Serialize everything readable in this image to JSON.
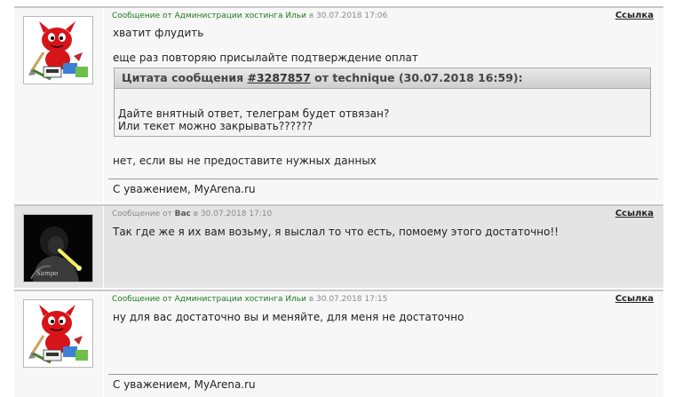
{
  "posts": [
    {
      "kind": "admin",
      "meta": {
        "prefix": "Сообщение от ",
        "author": "Администрации хостинга Ильи",
        "in": " в ",
        "datetime": "30.07.2018 17:06"
      },
      "link_label": "Ссылка",
      "lines": [
        "хватит флудить",
        "еще раз повторяю присылайте подтверждение оплат"
      ],
      "quote": {
        "prefix": "Цитата сообщения ",
        "number": "#3287857",
        "suffix": " от technique (30.07.2018 16:59):",
        "lines": [
          "Дайте внятный ответ, телеграм будет отвязан?",
          "Или текет можно закрывать??????"
        ]
      },
      "after_quote": "нет, если вы не предоставите нужных данных",
      "signature": "С уважением, MyArena.ru"
    },
    {
      "kind": "user",
      "meta": {
        "prefix": "Сообщение от ",
        "author": "Вас",
        "in": " в ",
        "datetime": "30.07.2018 17:10"
      },
      "link_label": "Ссылка",
      "lines": [
        "Так где же я их вам возьму, я выслал то что есть, помоему этого достаточно!!"
      ]
    },
    {
      "kind": "admin",
      "meta": {
        "prefix": "Сообщение от ",
        "author": "Администрации хостинга Ильи",
        "in": " в ",
        "datetime": "30.07.2018 17:15"
      },
      "link_label": "Ссылка",
      "lines": [
        "ну для вас достаточно вы и меняйте, для меня не достаточно"
      ],
      "signature": "С уважением, MyArena.ru"
    }
  ],
  "colors": {
    "admin_author": "#1f7a1f",
    "admin_bg": "#f7f7f7",
    "user_bg": "#e4e4e4"
  },
  "icons": {
    "admin_avatar": "red-devil-mascot",
    "user_avatar": "dark-photo-avatar"
  }
}
